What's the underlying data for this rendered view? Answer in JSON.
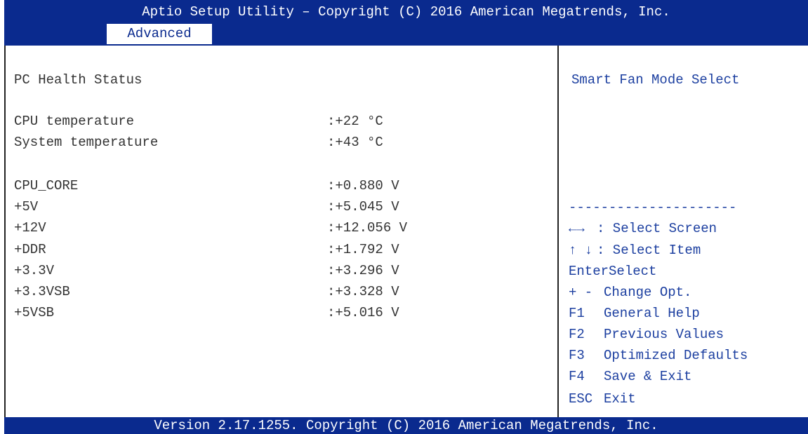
{
  "title": "Aptio Setup Utility – Copyright (C) 2016 American Megatrends, Inc.",
  "tab": "Advanced",
  "section_title": "PC Health Status",
  "temperatures": [
    {
      "label": "CPU temperature",
      "value": ":+22 °C"
    },
    {
      "label": "System temperature",
      "value": ":+43 °C"
    }
  ],
  "voltages": [
    {
      "label": "CPU_CORE",
      "value": ":+0.880 V"
    },
    {
      "label": "+5V",
      "value": ":+5.045 V"
    },
    {
      "label": "+12V",
      "value": ":+12.056 V"
    },
    {
      "label": "+DDR",
      "value": ":+1.792 V"
    },
    {
      "label": "+3.3V",
      "value": ":+3.296 V"
    },
    {
      "label": "+3.3VSB",
      "value": ":+3.328 V"
    },
    {
      "label": "+5VSB",
      "value": ":+5.016 V"
    }
  ],
  "help_text": "Smart Fan Mode Select",
  "separator": "---------------------",
  "keys": [
    {
      "key": "←→",
      "desc": ": Select Screen"
    },
    {
      "key": "↑ ↓",
      "desc": ": Select Item"
    },
    {
      "key": "Enter",
      "desc": "Select"
    },
    {
      "key": "+ -",
      "desc": "Change Opt."
    },
    {
      "key": "F1",
      "desc": "General Help"
    },
    {
      "key": "F2",
      "desc": "Previous Values"
    },
    {
      "key": "F3",
      "desc": "Optimized Defaults"
    },
    {
      "key": "F4",
      "desc": "Save & Exit"
    },
    {
      "key": "ESC",
      "desc": "Exit"
    }
  ],
  "footer": "Version 2.17.1255. Copyright (C) 2016 American Megatrends, Inc.",
  "colors": {
    "bar": "#0a2a8e",
    "help": "#1c3fa0",
    "text": "#333333"
  }
}
